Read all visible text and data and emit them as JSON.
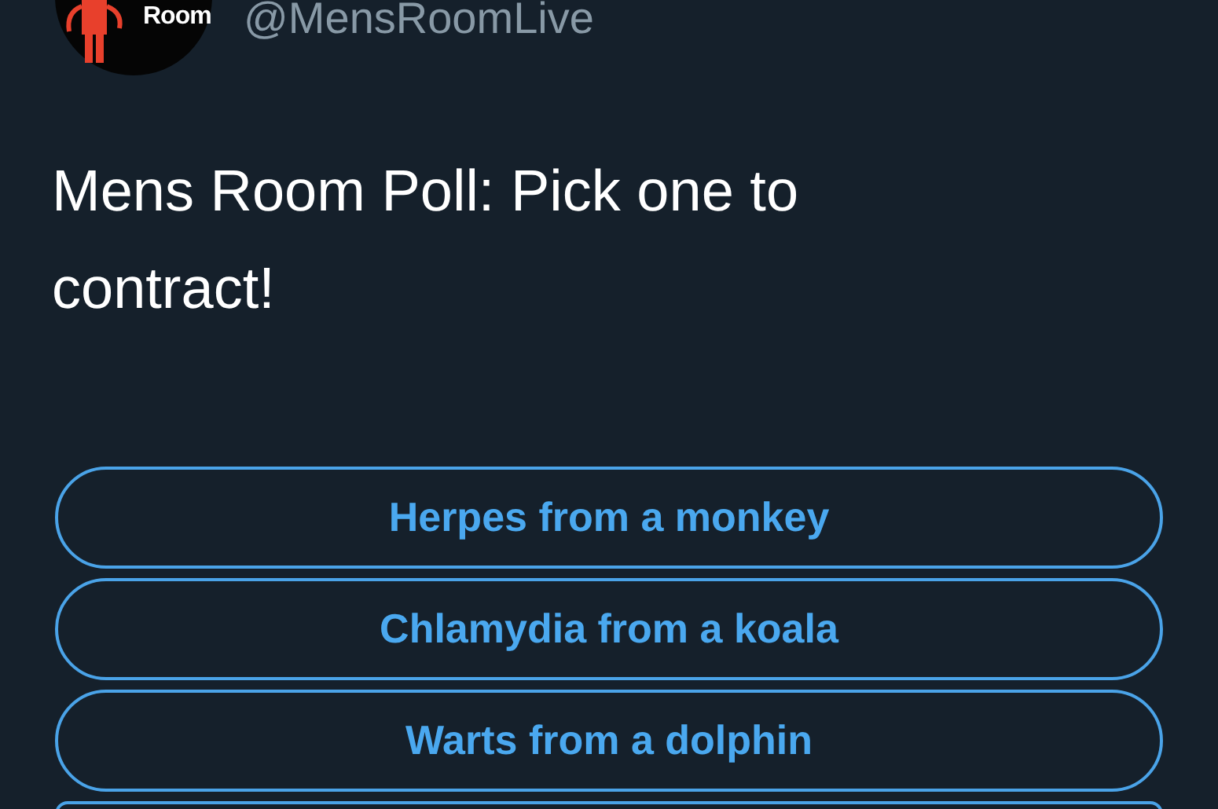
{
  "author": {
    "avatar_text": "Room",
    "handle": "@MensRoomLive"
  },
  "tweet_text": "Mens Room Poll: Pick one to contract!",
  "poll": {
    "options": [
      {
        "label": "Herpes from a monkey"
      },
      {
        "label": "Chlamydia from a koala"
      },
      {
        "label": "Warts from a dolphin"
      }
    ],
    "more_below": true
  }
}
